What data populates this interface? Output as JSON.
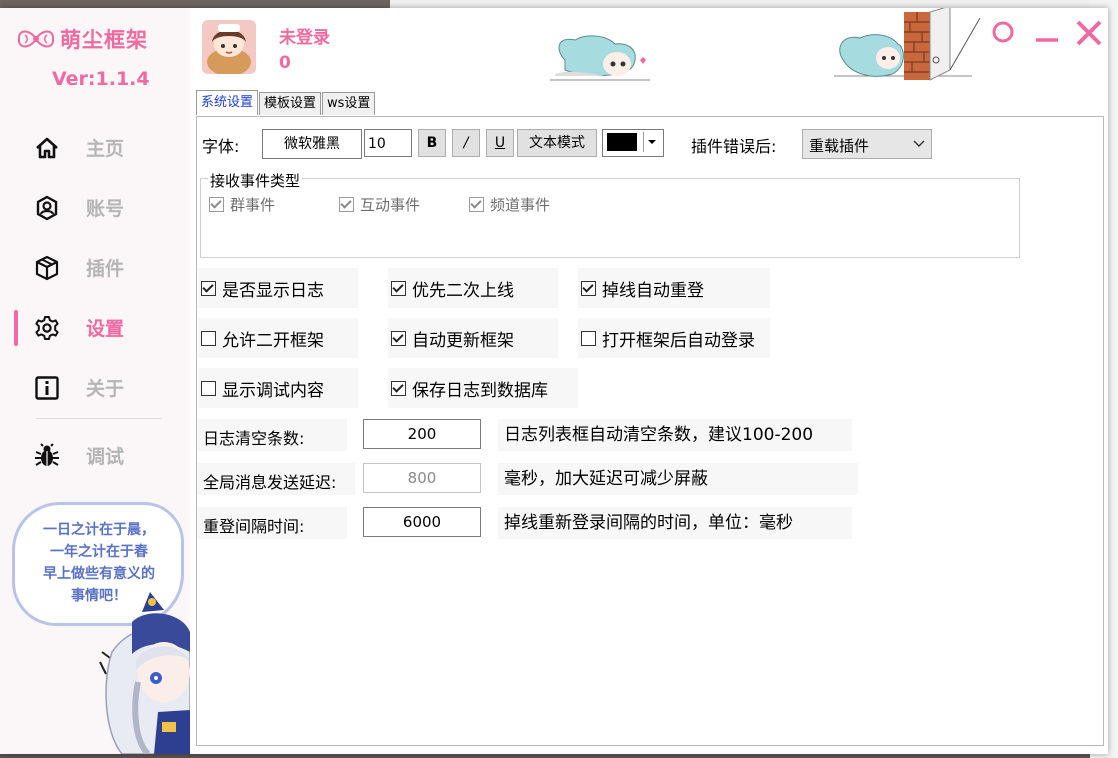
{
  "app": {
    "name": "萌尘框架",
    "version": "Ver:1.1.4",
    "login_status": "未登录",
    "login_count": "0"
  },
  "nav": {
    "items": [
      {
        "label": "主页",
        "icon": "home-icon"
      },
      {
        "label": "账号",
        "icon": "account-icon"
      },
      {
        "label": "插件",
        "icon": "plugin-cube-icon"
      },
      {
        "label": "设置",
        "icon": "gear-icon"
      },
      {
        "label": "关于",
        "icon": "info-icon"
      }
    ],
    "active": "设置",
    "debug_label": "调试"
  },
  "bubble_text": [
    "一日之计在于晨，",
    "一年之计在于春",
    "早上做些有意义的",
    "事情吧！"
  ],
  "tabs": [
    "系统设置",
    "模板设置",
    "ws设置"
  ],
  "font_settings": {
    "label": "字体:",
    "font_name": "微软雅黑",
    "font_size": "10",
    "bold_btn": "B",
    "italic_btn": "/",
    "underline_btn": "U",
    "text_mode_btn": "文本模式",
    "color": "#000000"
  },
  "plugin_error": {
    "label": "插件错误后:",
    "selected": "重载插件"
  },
  "event_group": {
    "title": "接收事件类型",
    "items": [
      {
        "label": "群事件",
        "checked": true
      },
      {
        "label": "互动事件",
        "checked": true
      },
      {
        "label": "频道事件",
        "checked": true
      }
    ]
  },
  "options": [
    {
      "label": "是否显示日志",
      "checked": true
    },
    {
      "label": "优先二次上线",
      "checked": true
    },
    {
      "label": "掉线自动重登",
      "checked": true
    },
    {
      "label": "允许二开框架",
      "checked": false
    },
    {
      "label": "自动更新框架",
      "checked": true
    },
    {
      "label": "打开框架后自动登录",
      "checked": false
    },
    {
      "label": "显示调试内容",
      "checked": false
    },
    {
      "label": "保存日志到数据库",
      "checked": true
    }
  ],
  "numeric_settings": [
    {
      "label": "日志清空条数:",
      "value": "200",
      "hint": "日志列表框自动清空条数，建议100-200",
      "disabled": false
    },
    {
      "label": "全局消息发送延迟:",
      "value": "800",
      "hint": "毫秒，加大延迟可减少屏蔽",
      "disabled": true
    },
    {
      "label": "重登间隔时间:",
      "value": "6000",
      "hint": "掉线重新登录间隔的时间，单位：毫秒",
      "disabled": false
    }
  ],
  "colors": {
    "accent": "#ef6aa0",
    "tab_active": "#1a3fd6"
  }
}
